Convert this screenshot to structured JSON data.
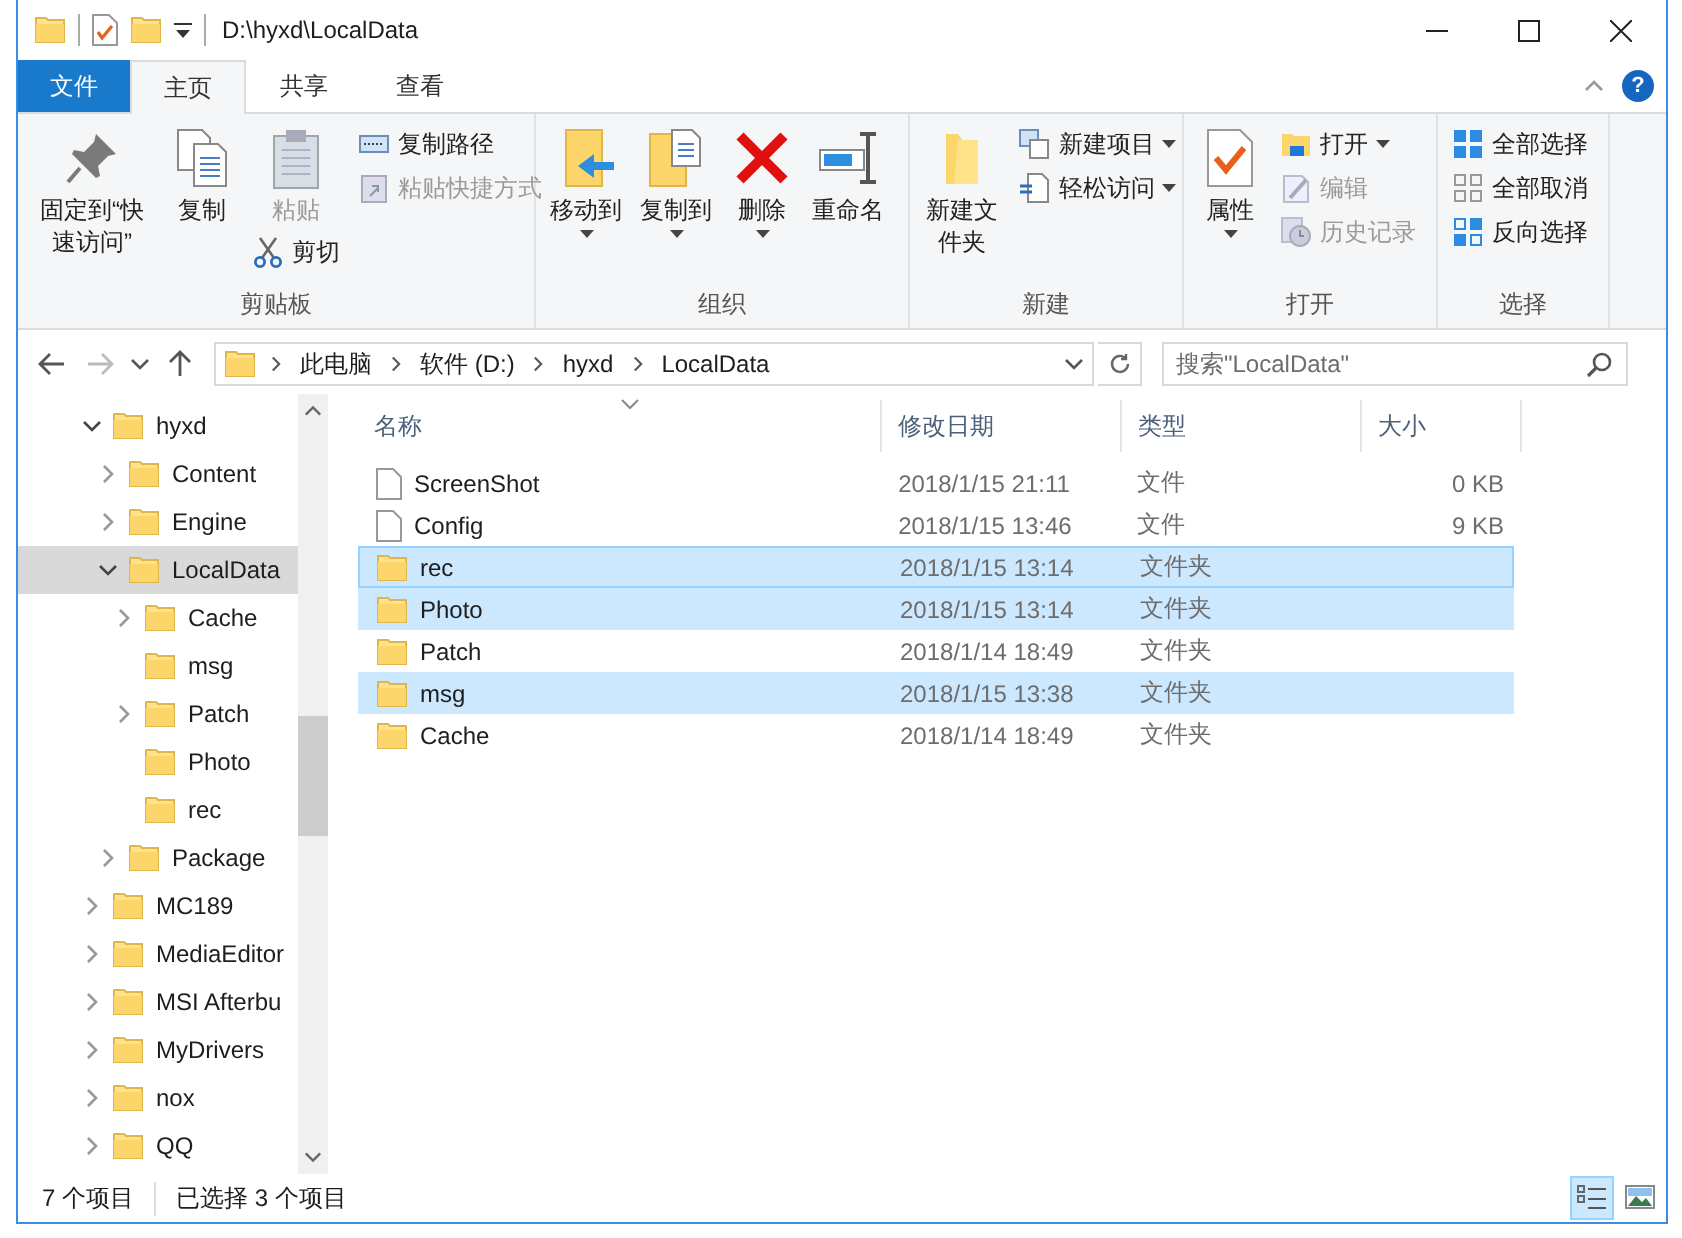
{
  "window": {
    "title": "D:\\hyxd\\LocalData"
  },
  "ribbon": {
    "tabs": [
      {
        "label": "文件",
        "kind": "file",
        "selected": false
      },
      {
        "label": "主页",
        "kind": "tab",
        "selected": true
      },
      {
        "label": "共享",
        "kind": "tab",
        "selected": false
      },
      {
        "label": "查看",
        "kind": "tab",
        "selected": false
      }
    ],
    "help": "?",
    "groups": [
      {
        "label": "剪贴板",
        "columns": [
          [
            {
              "label": "固定到“快速访问”",
              "kind": "large",
              "disabled": false,
              "dropdown": false
            }
          ],
          [
            {
              "label": "复制",
              "kind": "large",
              "disabled": false,
              "dropdown": false
            }
          ],
          [
            {
              "label": "粘贴",
              "kind": "large",
              "disabled": true,
              "dropdown": false
            },
            {
              "label": "剪切",
              "kind": "small",
              "disabled": false,
              "dropdown": false
            }
          ],
          [
            {
              "label": "复制路径",
              "kind": "small",
              "disabled": false,
              "dropdown": false
            },
            {
              "label": "粘贴快捷方式",
              "kind": "small",
              "disabled": true,
              "dropdown": false
            }
          ]
        ]
      },
      {
        "label": "组织",
        "columns": [
          [
            {
              "label": "移动到",
              "kind": "large",
              "disabled": false,
              "dropdown": true
            }
          ],
          [
            {
              "label": "复制到",
              "kind": "large",
              "disabled": false,
              "dropdown": true
            }
          ],
          [
            {
              "label": "删除",
              "kind": "large",
              "disabled": false,
              "dropdown": true
            }
          ],
          [
            {
              "label": "重命名",
              "kind": "large",
              "disabled": false,
              "dropdown": false
            }
          ]
        ]
      },
      {
        "label": "新建",
        "columns": [
          [
            {
              "label": "新建文件夹",
              "kind": "large",
              "disabled": false,
              "dropdown": false
            }
          ],
          [
            {
              "label": "新建项目",
              "kind": "small",
              "disabled": false,
              "dropdown": true
            },
            {
              "label": "轻松访问",
              "kind": "small",
              "disabled": false,
              "dropdown": true
            }
          ]
        ]
      },
      {
        "label": "打开",
        "columns": [
          [
            {
              "label": "属性",
              "kind": "large",
              "disabled": false,
              "dropdown": true
            }
          ],
          [
            {
              "label": "打开",
              "kind": "small",
              "disabled": false,
              "dropdown": true
            },
            {
              "label": "编辑",
              "kind": "small",
              "disabled": true,
              "dropdown": false
            },
            {
              "label": "历史记录",
              "kind": "small",
              "disabled": true,
              "dropdown": false
            }
          ]
        ]
      },
      {
        "label": "选择",
        "columns": [
          [
            {
              "label": "全部选择",
              "kind": "small",
              "disabled": false,
              "dropdown": false
            },
            {
              "label": "全部取消",
              "kind": "small",
              "disabled": false,
              "dropdown": false
            },
            {
              "label": "反向选择",
              "kind": "small",
              "disabled": false,
              "dropdown": false
            }
          ]
        ]
      }
    ]
  },
  "nav": {
    "buttons": [
      {
        "kind": "back",
        "disabled": false
      },
      {
        "kind": "forward",
        "disabled": true
      },
      {
        "kind": "recent",
        "disabled": false
      },
      {
        "kind": "up",
        "disabled": false
      }
    ],
    "address": [
      "此电脑",
      "软件 (D:)",
      "hyxd",
      "LocalData"
    ],
    "search": {
      "placeholder": "搜索\"LocalData\""
    }
  },
  "tree": [
    {
      "name": "hyxd",
      "expandable": true,
      "expanded": true,
      "selected": false,
      "children": [
        {
          "name": "Content",
          "expandable": true,
          "expanded": false,
          "selected": false
        },
        {
          "name": "Engine",
          "expandable": true,
          "expanded": false,
          "selected": false
        },
        {
          "name": "LocalData",
          "expandable": true,
          "expanded": true,
          "selected": true,
          "children": [
            {
              "name": "Cache",
              "expandable": true,
              "expanded": false,
              "selected": false
            },
            {
              "name": "msg",
              "expandable": false,
              "selected": false
            },
            {
              "name": "Patch",
              "expandable": true,
              "expanded": false,
              "selected": false
            },
            {
              "name": "Photo",
              "expandable": false,
              "selected": false
            },
            {
              "name": "rec",
              "expandable": false,
              "selected": false
            }
          ]
        },
        {
          "name": "Package",
          "expandable": true,
          "expanded": false,
          "selected": false
        }
      ]
    },
    {
      "name": "MC189",
      "expandable": true,
      "expanded": false,
      "selected": false
    },
    {
      "name": "MediaEditor",
      "expandable": true,
      "expanded": false,
      "selected": false
    },
    {
      "name": "MSI Afterbu",
      "expandable": true,
      "expanded": false,
      "selected": false
    },
    {
      "name": "MyDrivers",
      "expandable": true,
      "expanded": false,
      "selected": false
    },
    {
      "name": "nox",
      "expandable": true,
      "expanded": false,
      "selected": false
    },
    {
      "name": "QQ",
      "expandable": true,
      "expanded": false,
      "selected": false
    }
  ],
  "file_list": {
    "columns": [
      {
        "label": "名称",
        "sorted": true
      },
      {
        "label": "修改日期",
        "sorted": false
      },
      {
        "label": "类型",
        "sorted": false
      },
      {
        "label": "大小",
        "sorted": false
      }
    ],
    "rows": [
      {
        "name": "ScreenShot",
        "kind": "file",
        "modified": "2018/1/15 21:11",
        "type": "文件",
        "size": "0 KB",
        "selected": false,
        "focused": false
      },
      {
        "name": "Config",
        "kind": "file",
        "modified": "2018/1/15 13:46",
        "type": "文件",
        "size": "9 KB",
        "selected": false,
        "focused": false
      },
      {
        "name": "rec",
        "kind": "folder",
        "modified": "2018/1/15 13:14",
        "type": "文件夹",
        "selected": true,
        "focused": true
      },
      {
        "name": "Photo",
        "kind": "folder",
        "modified": "2018/1/15 13:14",
        "type": "文件夹",
        "selected": true,
        "focused": false
      },
      {
        "name": "Patch",
        "kind": "folder",
        "modified": "2018/1/14 18:49",
        "type": "文件夹",
        "selected": false,
        "focused": false
      },
      {
        "name": "msg",
        "kind": "folder",
        "modified": "2018/1/15 13:38",
        "type": "文件夹",
        "selected": true,
        "focused": false
      },
      {
        "name": "Cache",
        "kind": "folder",
        "modified": "2018/1/14 18:49",
        "type": "文件夹",
        "selected": false,
        "focused": false
      }
    ]
  },
  "status_bar": {
    "item_count": "7 个项目",
    "selection": "已选择 3 个项目",
    "views": [
      {
        "kind": "details",
        "selected": true
      },
      {
        "kind": "large_icons",
        "selected": false
      }
    ]
  }
}
